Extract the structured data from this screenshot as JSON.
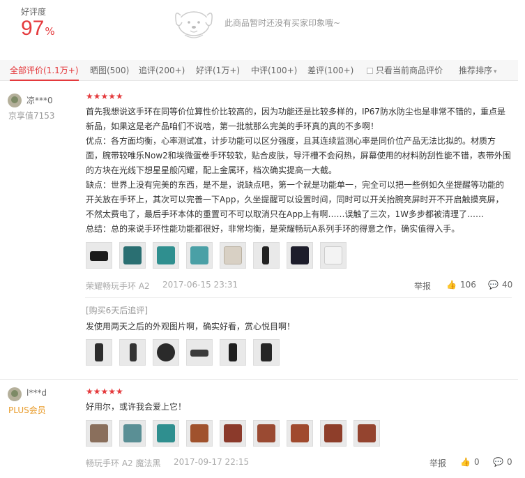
{
  "rating": {
    "label": "好评度",
    "value": "97",
    "unit": "%"
  },
  "no_impression_text": "此商品暂时还没有买家印象哦~",
  "filters": [
    {
      "label": "全部评价(1.1万+)",
      "active": true
    },
    {
      "label": "晒图(500)"
    },
    {
      "label": "追评(200+)"
    },
    {
      "label": "好评(1万+)"
    },
    {
      "label": "中评(100+)"
    },
    {
      "label": "差评(100+)"
    },
    {
      "label": "只看当前商品评价"
    },
    {
      "label": "推荐排序"
    }
  ],
  "reviews": [
    {
      "username": "凉***0",
      "level": "京享值7153",
      "stars": "★★★★★",
      "paragraphs": [
        "首先我想说这手环在同等价位算性价比较高的，因为功能还是比较多样的，IP67防水防尘也是非常不错的，重点是新品，如果这是老产品咱们不说啥，第一批就那么完美的手环真的真的不多啊！",
        "优点：各方面均衡，心率测试准，计步功能可以区分强度，且其连续监测心率是同价位产品无法比拟的。材质方面，腕带较唯乐Now2和埃微蛋卷手环较软，贴合皮肤，导汗槽不会闷热，屏幕使用的材料防刮性能不错，表带外围的方块在光线下想星星般闪耀，配上金属环，档次确实提高一大截。",
        "缺点：世界上没有完美的东西，是不是，说缺点吧，第一个就是功能单一，完全可以把一些例如久坐提醒等功能的开关放在手环上，其次可以完善一下App，久坐提醒可以设置时间，同时可以开关抬腕亮屏时开不开启触摸亮屏，不然太费电了，最后手环本体的重置可不可以取消只在App上有啊……误触了三次，1W多步都被清理了……",
        "总结：总的来说手环性能功能都很好，非常均衡，是荣耀畅玩A系列手环的得意之作，确实值得入手。"
      ],
      "product": "荣耀畅玩手环 A2",
      "date": "2017-06-15 23:31",
      "report": "举报",
      "likes": "106",
      "comments": "40",
      "append_label": "[购买6天后追评]",
      "append_text": "发使用两天之后的外观图片啊，确实好看，赏心悦目啊！"
    },
    {
      "username": "l***d",
      "level": "PLUS会员",
      "stars": "★★★★★",
      "text": "好用尔，或许我会爱上它！",
      "product": "畅玩手环 A2 魔法黑",
      "date": "2017-09-17 22:15",
      "report": "举报",
      "likes": "0",
      "comments": "0"
    }
  ],
  "icons": {
    "like": "thumbs-up-icon",
    "comment": "comment-bubble-icon"
  },
  "colors": {
    "accent": "#e4393c",
    "plus": "#e89b2a"
  }
}
